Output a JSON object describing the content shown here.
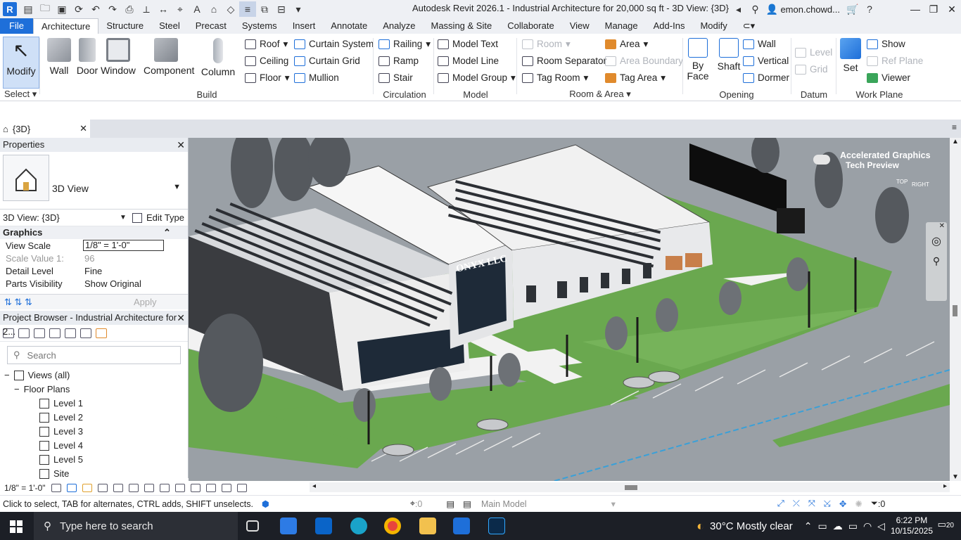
{
  "titlebar": {
    "app_title": "Autodesk Revit 2026.1 - Industrial Architecture for 20,000 sq ft - 3D View: {3D}",
    "user": "emon.chowd..."
  },
  "tabs": [
    {
      "label": "File"
    },
    {
      "label": "Architecture"
    },
    {
      "label": "Structure"
    },
    {
      "label": "Steel"
    },
    {
      "label": "Precast"
    },
    {
      "label": "Systems"
    },
    {
      "label": "Insert"
    },
    {
      "label": "Annotate"
    },
    {
      "label": "Analyze"
    },
    {
      "label": "Massing & Site"
    },
    {
      "label": "Collaborate"
    },
    {
      "label": "View"
    },
    {
      "label": "Manage"
    },
    {
      "label": "Add-Ins"
    },
    {
      "label": "Modify"
    }
  ],
  "ribbon": {
    "select": {
      "modify": "Modify",
      "panel": "Select"
    },
    "build": {
      "wall": "Wall",
      "door": "Door",
      "window": "Window",
      "component": "Component",
      "column": "Column",
      "roof": "Roof",
      "ceiling": "Ceiling",
      "floor": "Floor",
      "curtain_system": "Curtain System",
      "curtain_grid": "Curtain Grid",
      "mullion": "Mullion",
      "panel": "Build"
    },
    "circulation": {
      "railing": "Railing",
      "ramp": "Ramp",
      "stair": "Stair",
      "panel": "Circulation"
    },
    "model": {
      "model_text": "Model Text",
      "model_line": "Model Line",
      "model_group": "Model Group",
      "panel": "Model"
    },
    "room_area": {
      "room": "Room",
      "room_separator": "Room Separator",
      "tag_room": "Tag Room",
      "area": "Area",
      "area_boundary": "Area Boundary",
      "tag_area": "Tag Area",
      "panel": "Room & Area"
    },
    "opening": {
      "by_face": "By Face",
      "shaft": "Shaft",
      "wall": "Wall",
      "vertical": "Vertical",
      "dormer": "Dormer",
      "panel": "Opening"
    },
    "datum": {
      "level": "Level",
      "grid": "Grid",
      "panel": "Datum"
    },
    "work_plane": {
      "set": "Set",
      "show": "Show",
      "ref_plane": "Ref Plane",
      "viewer": "Viewer",
      "panel": "Work Plane"
    }
  },
  "view_tab": {
    "label": "{3D}"
  },
  "properties": {
    "title": "Properties",
    "type_name": "3D View",
    "instance": "3D View: {3D}",
    "edit_type": "Edit Type",
    "section": "Graphics",
    "rows": [
      {
        "k": "View Scale",
        "v": "1/8\" = 1'-0\""
      },
      {
        "k": "Scale Value    1:",
        "v": "96"
      },
      {
        "k": "Detail Level",
        "v": "Fine"
      },
      {
        "k": "Parts Visibility",
        "v": "Show Original"
      }
    ],
    "apply": "Apply"
  },
  "browser": {
    "title": "Project Browser - Industrial Architecture for 2...",
    "search_placeholder": "Search",
    "root": "Views (all)",
    "group": "Floor Plans",
    "items": [
      "Level 1",
      "Level 2",
      "Level 3",
      "Level 4",
      "Level 5",
      "Site"
    ]
  },
  "viewport": {
    "overlay_title": "Accelerated Graphics",
    "overlay_sub": "Tech Preview",
    "sign_text": "ONYX LLC",
    "viewcube_top": "TOP",
    "viewcube_right": "RIGHT"
  },
  "view_control": {
    "scale": "1/8\" = 1'-0\""
  },
  "status": {
    "hint": "Click to select, TAB for alternates, CTRL adds, SHIFT unselects.",
    "sel_count": ":0",
    "workset": "Main Model",
    "filter_count": ":0"
  },
  "taskbar": {
    "search_placeholder": "Type here to search",
    "weather": "30°C  Mostly clear",
    "time": "6:22 PM",
    "date": "10/15/2025",
    "notif": "20"
  },
  "colors": {
    "revit_blue": "#1e6fd9",
    "grass": "#6aa84f",
    "asphalt": "#9aa0a6"
  }
}
